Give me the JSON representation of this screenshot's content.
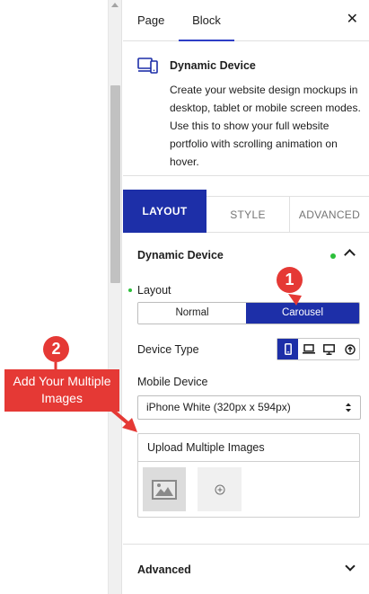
{
  "sidebar_tabs": {
    "page": "Page",
    "block": "Block",
    "close": "✕"
  },
  "block": {
    "title": "Dynamic Device",
    "description": "Create your website design mockups in desktop, tablet or mobile screen modes. Use this to show your full website portfolio with scrolling animation on hover.",
    "icon": "devices-icon"
  },
  "style_tabs": {
    "layout": "LAYOUT",
    "style": "STYLE",
    "advanced": "ADVANCED"
  },
  "dynamic_device_section": {
    "title": "Dynamic Device",
    "layout_label": "Layout",
    "layout_options": [
      "Normal",
      "Carousel"
    ],
    "layout_selected": "Carousel",
    "device_type_label": "Device Type",
    "device_types": [
      "mobile-icon",
      "laptop-icon",
      "desktop-icon",
      "custom-icon"
    ],
    "device_type_selected": "mobile-icon",
    "mobile_device_label": "Mobile Device",
    "mobile_device_value": "iPhone White (320px x 594px)",
    "upload_label": "Upload Multiple Images"
  },
  "advanced_section": {
    "title": "Advanced"
  },
  "annotations": {
    "badge_1": "1",
    "badge_2": "2",
    "callout": "Add Your Multiple Images"
  },
  "colors": {
    "accent": "#1d2fa8",
    "annotation": "#e53935",
    "status_dot": "#2cbf3a"
  }
}
